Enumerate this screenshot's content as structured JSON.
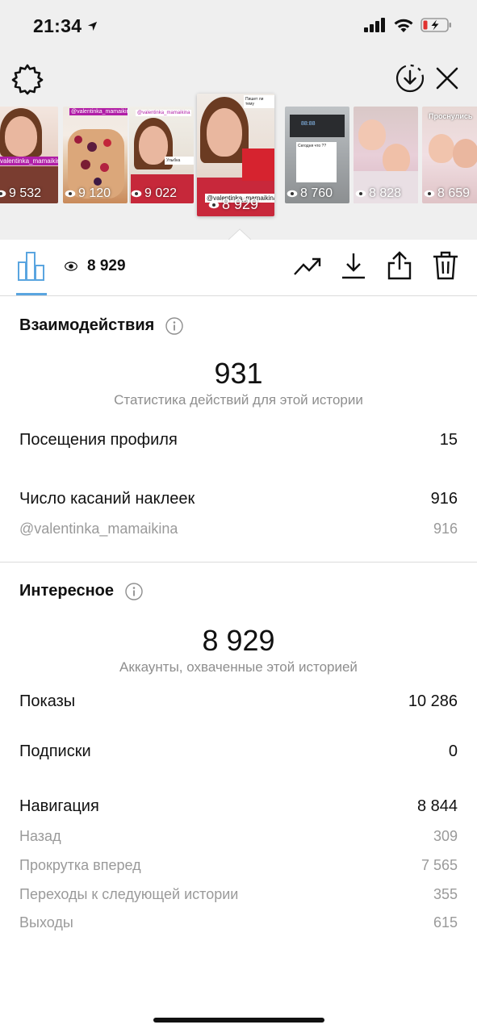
{
  "status_bar": {
    "time": "21:34"
  },
  "thumbnails": [
    {
      "views": "9 532",
      "tag": "valentinka_mamaikina"
    },
    {
      "views": "9 120",
      "tag": "@valentinka_mamaikina"
    },
    {
      "views": "9 022",
      "tag": "@valentinka_mamaikina"
    },
    {
      "views": "8 929",
      "tag": "@valentinka_mamaikina",
      "selected": true
    },
    {
      "views": "8 760",
      "tag": ""
    },
    {
      "views": "8 828",
      "tag": ""
    },
    {
      "views": "8 659",
      "tag": "Проснулись"
    }
  ],
  "toolbar": {
    "views": "8 929"
  },
  "interactions": {
    "title": "Взаимодействия",
    "total": "931",
    "caption": "Статистика действий для этой истории",
    "profile_visits_label": "Посещения профиля",
    "profile_visits_value": "15",
    "sticker_taps_label": "Число касаний наклеек",
    "sticker_taps_value": "916",
    "sticker_mention_label": "@valentinka_mamaikina",
    "sticker_mention_value": "916"
  },
  "discovery": {
    "title": "Интересное",
    "reach": "8 929",
    "caption": "Аккаунты, охваченные этой историей",
    "impressions_label": "Показы",
    "impressions_value": "10 286",
    "follows_label": "Подписки",
    "follows_value": "0",
    "navigation_label": "Навигация",
    "navigation_value": "8 844",
    "back_label": "Назад",
    "back_value": "309",
    "forward_label": "Прокрутка вперед",
    "forward_value": "7 565",
    "next_story_label": "Переходы к следующей истории",
    "next_story_value": "355",
    "exits_label": "Выходы",
    "exits_value": "615"
  },
  "colors": {
    "accent": "#5aa5e0",
    "muted": "#8e8e8e",
    "background_top": "#efefef"
  }
}
